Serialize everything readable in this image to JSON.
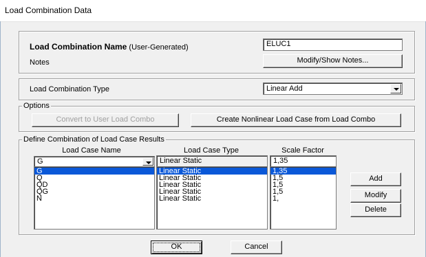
{
  "window": {
    "title": "Load Combination Data"
  },
  "name_section": {
    "name_label": "Load Combination Name",
    "name_suffix": "(User-Generated)",
    "name_value": "ELUC1",
    "notes_label": "Notes",
    "notes_button": "Modify/Show Notes..."
  },
  "type_section": {
    "label": "Load Combination Type",
    "selected": "Linear Add"
  },
  "options": {
    "legend": "Options",
    "convert_button": "Convert to User Load Combo",
    "create_button": "Create Nonlinear Load Case from Load Combo"
  },
  "define": {
    "legend": "Define Combination of Load Case Results",
    "headers": {
      "name": "Load Case Name",
      "type": "Load Case Type",
      "scale": "Scale Factor"
    },
    "current": {
      "name": "G",
      "type": "Linear Static",
      "scale": "1,35"
    },
    "rows": [
      {
        "name": "G",
        "type": "Linear Static",
        "scale": "1,35"
      },
      {
        "name": "Q",
        "type": "Linear Static",
        "scale": "1,5"
      },
      {
        "name": "QD",
        "type": "Linear Static",
        "scale": "1,5"
      },
      {
        "name": "QG",
        "type": "Linear Static",
        "scale": "1,5"
      },
      {
        "name": "N",
        "type": "Linear Static",
        "scale": "1,"
      }
    ],
    "add_button": "Add",
    "modify_button": "Modify",
    "delete_button": "Delete"
  },
  "footer": {
    "ok_button": "OK",
    "cancel_button": "Cancel"
  }
}
